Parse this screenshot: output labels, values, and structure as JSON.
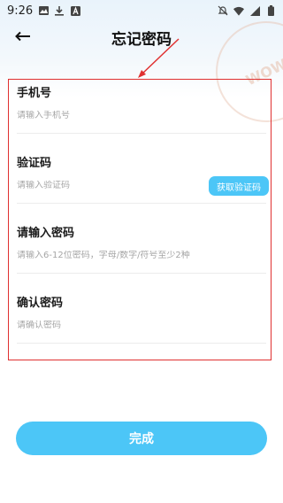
{
  "status_bar": {
    "time": "9:26"
  },
  "header": {
    "title": "忘记密码"
  },
  "watermark": {
    "text": "WOW"
  },
  "form": {
    "fields": [
      {
        "label": "手机号",
        "placeholder": "请输入手机号"
      },
      {
        "label": "验证码",
        "placeholder": "请输入验证码"
      },
      {
        "label": "请输入密码",
        "placeholder": "请输入6-12位密码，字母/数字/符号至少2种"
      },
      {
        "label": "确认密码",
        "placeholder": "请确认密码"
      }
    ],
    "get_code_label": "获取验证码"
  },
  "submit_label": "完成",
  "colors": {
    "accent": "#4cc6f7",
    "annotation": "#e03030"
  },
  "icons": {
    "back": "back-arrow-icon",
    "status": [
      "image-icon",
      "download-icon",
      "a-app-icon",
      "mute-icon",
      "wifi-icon",
      "signal-icon",
      "battery-icon"
    ]
  }
}
